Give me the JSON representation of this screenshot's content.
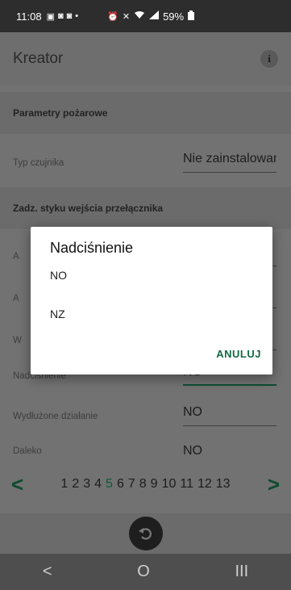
{
  "status_bar": {
    "time": "11:08",
    "left_icons": [
      "▣",
      "◙",
      "◙",
      "•"
    ],
    "right_icons": [
      "⏰",
      "✕",
      "wifi",
      "signal"
    ],
    "battery": "59%"
  },
  "app_bar": {
    "title": "Kreator",
    "info_label": "i"
  },
  "sections": {
    "fire_params": "Parametry pożarowe",
    "switch_contact": "Zadz. styku wejścia przełącznika"
  },
  "rows": [
    {
      "label": "Typ czujnika",
      "value": "Nie zainstalowany"
    },
    {
      "label": "A",
      "value": ""
    },
    {
      "label": "A",
      "value": ""
    },
    {
      "label": "W",
      "value": ""
    },
    {
      "label": "Nadciśnienie",
      "value": "NO"
    },
    {
      "label": "Wydłużone działanie",
      "value": "NO"
    },
    {
      "label": "Daleko",
      "value": "NO"
    }
  ],
  "pager": {
    "prev": "<",
    "next": ">",
    "pages": [
      "1",
      "2",
      "3",
      "4",
      "5",
      "6",
      "7",
      "8",
      "9",
      "10",
      "11",
      "12",
      "13"
    ],
    "current": "5"
  },
  "dialog": {
    "title": "Nadciśnienie",
    "options": [
      "NO",
      "NZ"
    ],
    "cancel": "ANULUJ"
  },
  "nav": {
    "back": "<",
    "home": "O",
    "recent": "III"
  },
  "colors": {
    "accent": "#116a45",
    "pager_current": "#0d5c34"
  }
}
